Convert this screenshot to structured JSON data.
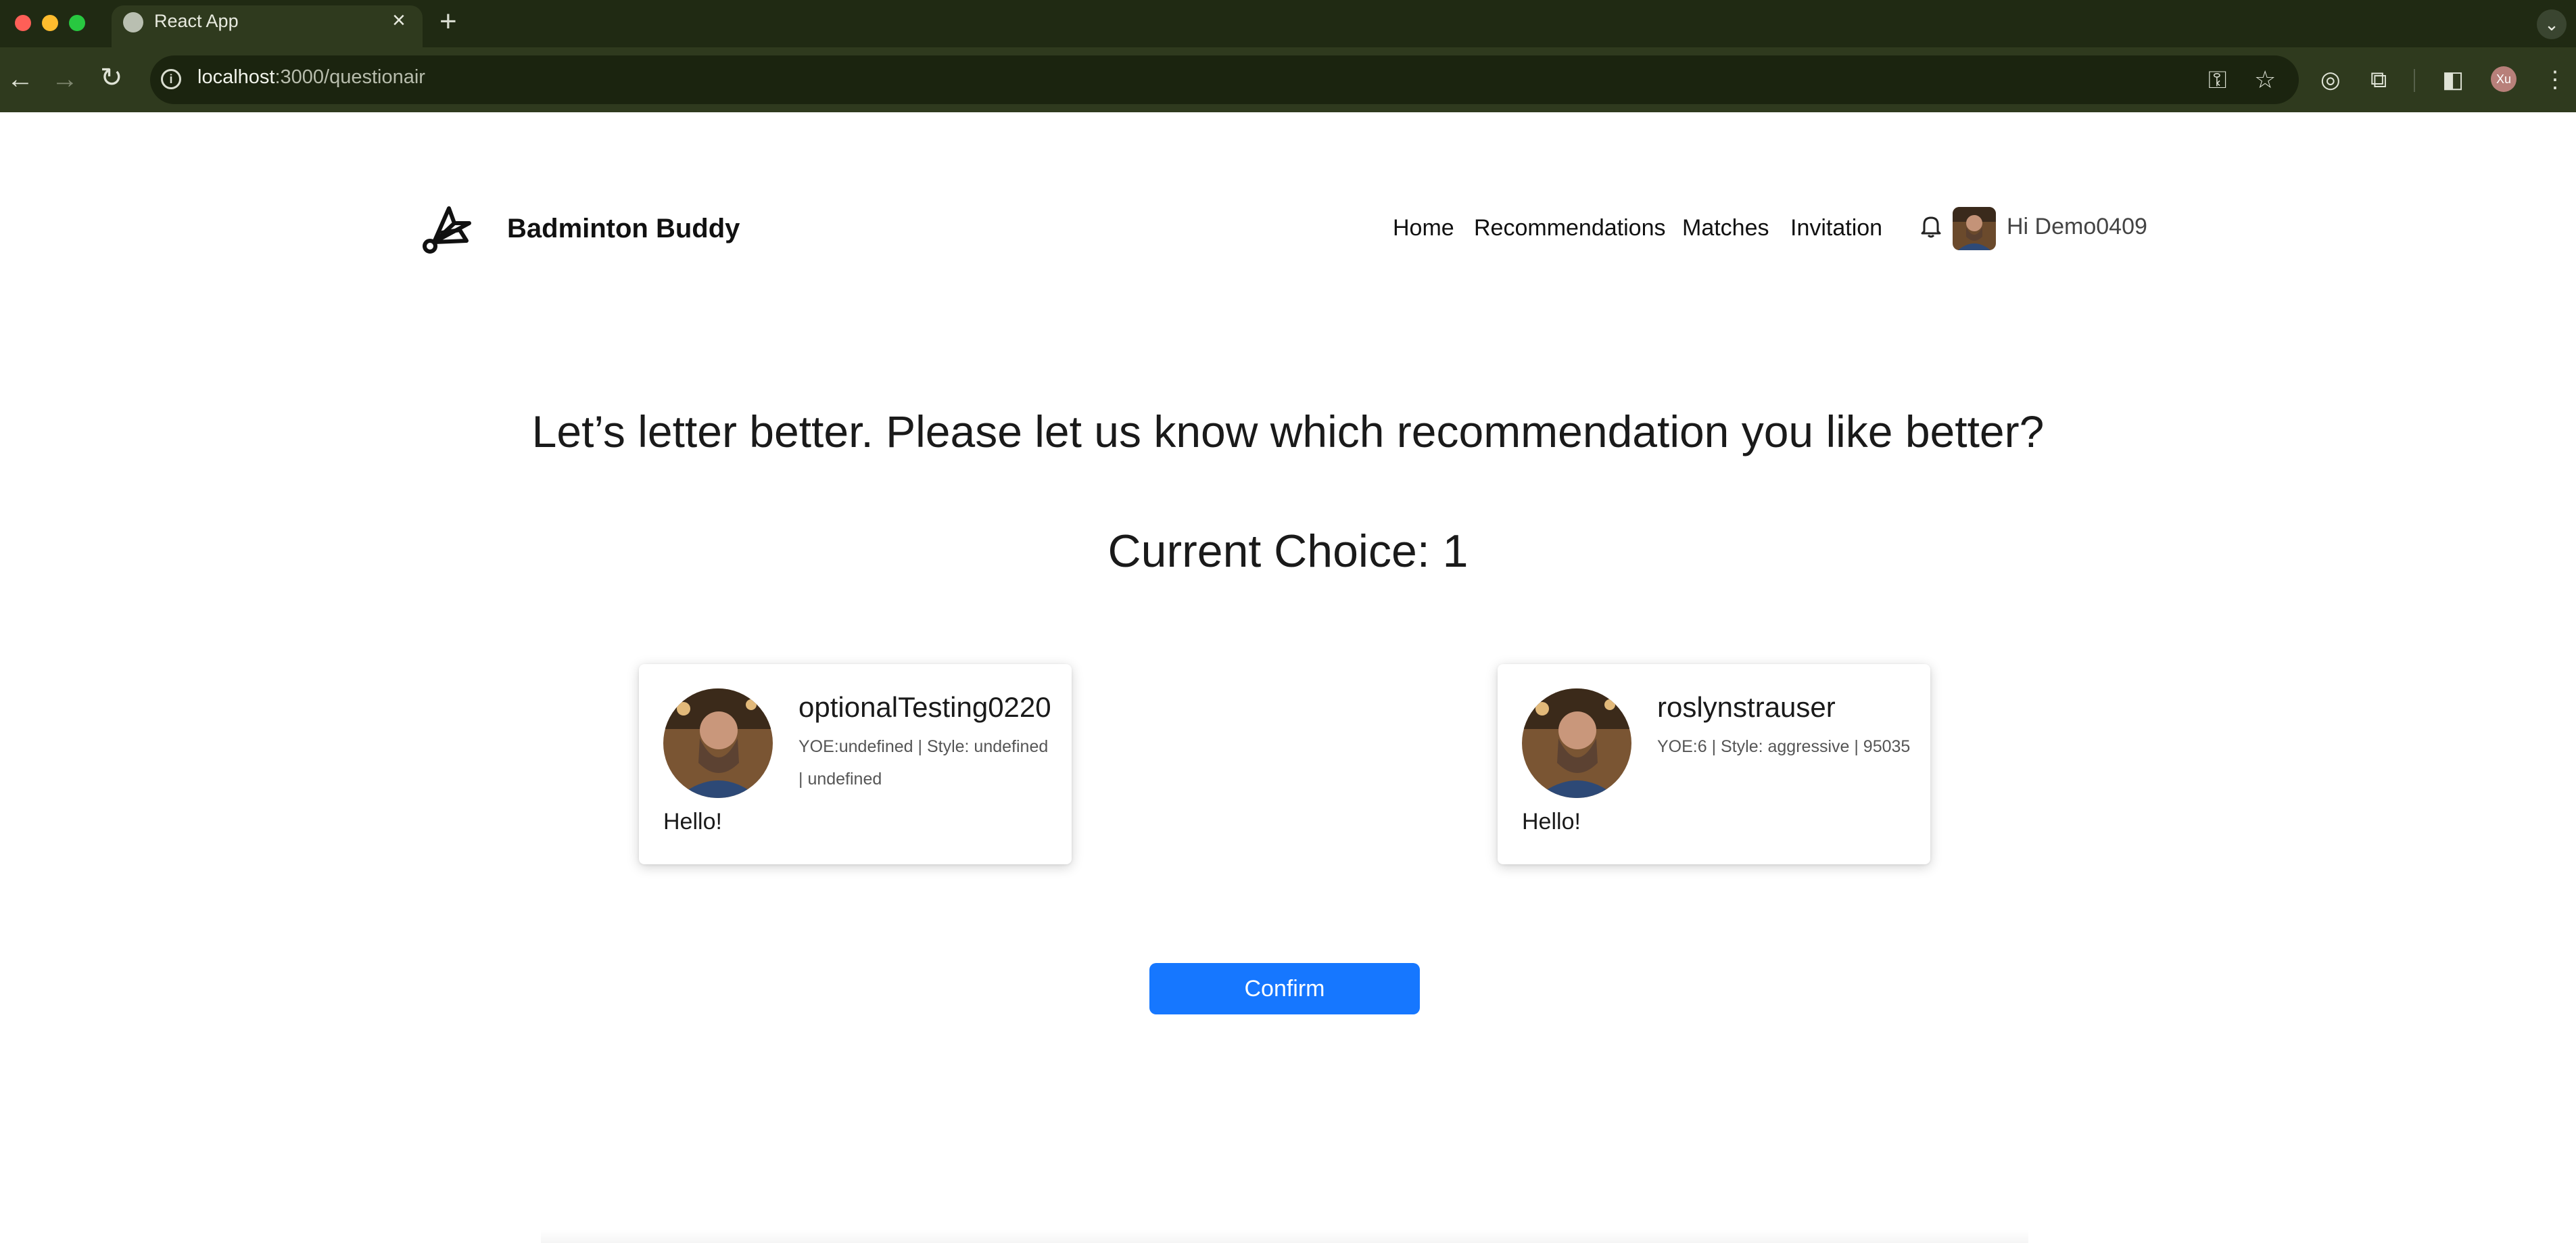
{
  "browser": {
    "tab_title": "React App",
    "url_host": "localhost",
    "url_rest": ":3000/questionair",
    "profile_initials": "Xu"
  },
  "nav": {
    "brand": "Badminton Buddy",
    "links": [
      "Home",
      "Recommendations",
      "Matches",
      "Invitation"
    ],
    "greeting": "Hi Demo0409"
  },
  "main": {
    "question": "Let’s letter better. Please let us know which recommendation you like better?",
    "current_choice": "Current Choice: 1",
    "cards": [
      {
        "name": "optionalTesting0220",
        "meta": "YOE:undefined | Style: undefined | undefined",
        "message": "Hello!"
      },
      {
        "name": "roslynstrauser",
        "meta": "YOE:6 | Style: aggressive | 95035",
        "message": "Hello!"
      }
    ],
    "confirm_label": "Confirm"
  },
  "colors": {
    "accent": "#1677ff",
    "chrome": "#2f3a1e"
  }
}
